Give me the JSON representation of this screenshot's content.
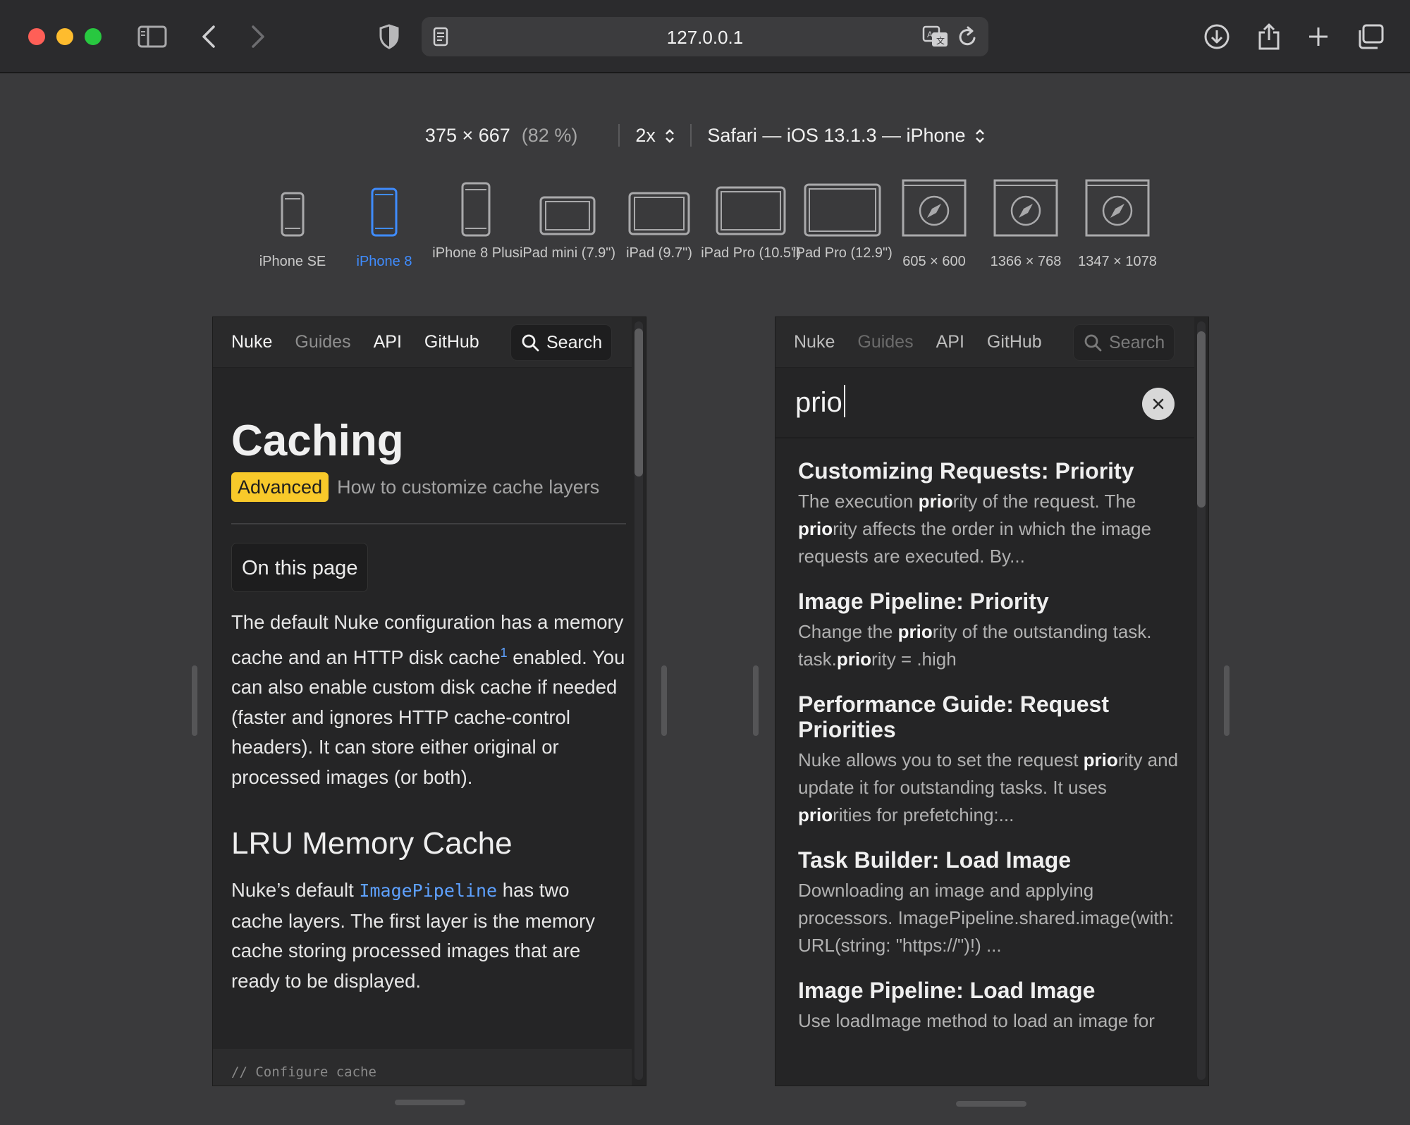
{
  "browser": {
    "url": "127.0.0.1",
    "icons": [
      "sidebar-icon",
      "back-icon",
      "forward-icon",
      "privacy-shield-icon",
      "reader-icon",
      "translate-icon",
      "reload-icon",
      "downloads-icon",
      "share-icon",
      "new-tab-icon",
      "tab-overview-icon"
    ]
  },
  "rdm": {
    "dimensions": "375 × 667",
    "percent": "(82 %)",
    "scale": "2x",
    "user_agent": "Safari — iOS 13.1.3 — iPhone",
    "devices": [
      {
        "label": "iPhone SE",
        "active": false
      },
      {
        "label": "iPhone 8",
        "active": true
      },
      {
        "label": "iPhone 8 Plus",
        "active": false
      },
      {
        "label": "iPad mini (7.9\")",
        "active": false
      },
      {
        "label": "iPad (9.7\")",
        "active": false
      },
      {
        "label": "iPad Pro (10.5\")",
        "active": false
      },
      {
        "label": "iPad Pro (12.9\")",
        "active": false
      },
      {
        "label": "605 × 600",
        "active": false
      },
      {
        "label": "1366 × 768",
        "active": false
      },
      {
        "label": "1347 × 1078",
        "active": false
      }
    ],
    "accent": "#3f8cff"
  },
  "site_nav": {
    "items": [
      "Nuke",
      "Guides",
      "API",
      "GitHub"
    ],
    "search_label": "Search"
  },
  "doc": {
    "title": "Caching",
    "badge": "Advanced",
    "subtitle": "How to customize cache layers",
    "on_this_page": "On this page",
    "para1_a": "The default Nuke configuration has a memory cache and an HTTP disk cache",
    "para1_sup": "1",
    "para1_b": " enabled. You can also enable custom disk cache if needed (faster and ignores HTTP cache-control headers). It can store either original or processed images (or both).",
    "h2": "LRU Memory Cache",
    "para2_a": "Nuke’s default ",
    "para2_code": "ImagePipeline",
    "para2_b": " has two cache layers. The first layer is the memory cache storing processed images that are ready to be displayed.",
    "code_comment": "// Configure cache"
  },
  "search": {
    "query": "prio",
    "results": [
      {
        "title": "Customizing Requests: Priority",
        "body": [
          "The execution ",
          "prio",
          "rity of the request. The ",
          "prio",
          "rity affects the order in which the image requests are executed. By..."
        ]
      },
      {
        "title": "Image Pipeline: Priority",
        "body": [
          "Change the ",
          "prio",
          "rity of the outstanding task. task.",
          "prio",
          "rity = .high"
        ]
      },
      {
        "title": "Performance Guide: Request Priorities",
        "body": [
          "Nuke allows you to set the request ",
          "prio",
          "rity and update it for outstanding tasks. It uses ",
          "prio",
          "rities for prefetching:..."
        ]
      },
      {
        "title": "Task Builder: Load Image",
        "body": [
          "Downloading an image and applying processors. ImagePipeline.shared.image(with: URL(string: \"https://\")!) ..."
        ]
      },
      {
        "title": "Image Pipeline: Load Image",
        "body": [
          "Use loadImage method to load an image for"
        ]
      }
    ]
  }
}
